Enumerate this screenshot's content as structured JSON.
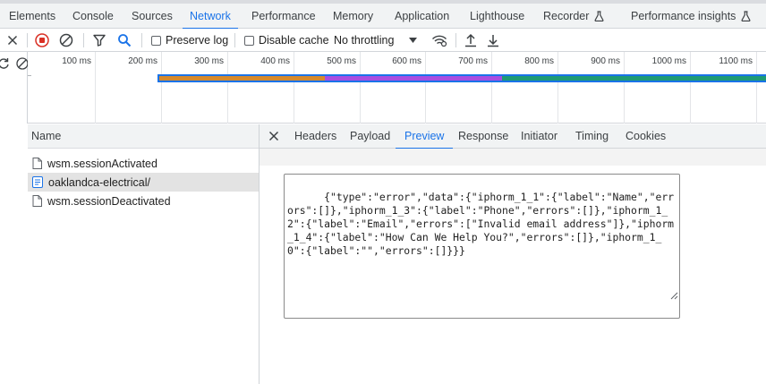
{
  "top_tabs": {
    "items": [
      {
        "label": "Elements"
      },
      {
        "label": "Console"
      },
      {
        "label": "Sources"
      },
      {
        "label": "Network",
        "active": true
      },
      {
        "label": "Performance"
      },
      {
        "label": "Memory"
      },
      {
        "label": "Application"
      },
      {
        "label": "Lighthouse"
      },
      {
        "label": "Recorder",
        "icon": "flask-icon"
      },
      {
        "label": "Performance insights",
        "icon": "flask-icon"
      }
    ]
  },
  "toolbar": {
    "preserve_log": "Preserve log",
    "preserve_log_checked": false,
    "disable_cache": "Disable cache",
    "disable_cache_checked": false,
    "throttling": "No throttling",
    "icons": [
      "close-icon",
      "stop-recording-icon",
      "clear-icon",
      "filter-icon",
      "search-icon",
      "dropdown-arrow-icon",
      "network-conditions-icon",
      "import-har-icon",
      "export-har-icon"
    ]
  },
  "overview": {
    "ticks": [
      "100 ms",
      "200 ms",
      "300 ms",
      "400 ms",
      "500 ms",
      "600 ms",
      "700 ms",
      "800 ms",
      "900 ms",
      "1000 ms",
      "1100 ms"
    ],
    "colors": {
      "orange": "#d68a2c",
      "purple": "#a94de0",
      "green": "#1e9b74",
      "outline": "#1a73e8"
    }
  },
  "request_list": {
    "header": "Name",
    "rows": [
      {
        "name": "wsm.sessionActivated",
        "icon": "document-icon",
        "selected": false
      },
      {
        "name": "oaklandca-electrical/",
        "icon": "document-type-icon",
        "selected": true
      },
      {
        "name": "wsm.sessionDeactivated",
        "icon": "document-icon",
        "selected": false
      }
    ]
  },
  "detail": {
    "tabs": [
      "Headers",
      "Payload",
      "Preview",
      "Response",
      "Initiator",
      "Timing",
      "Cookies"
    ],
    "active_tab": "Preview",
    "preview_text": "{\"type\":\"error\",\"data\":{\"iphorm_1_1\":{\"label\":\"Name\",\"errors\":[]},\"iphorm_1_3\":{\"label\":\"Phone\",\"errors\":[]},\"iphorm_1_2\":{\"label\":\"Email\",\"errors\":[\"Invalid email address\"]},\"iphorm_1_4\":{\"label\":\"How Can We Help You?\",\"errors\":[]},\"iphorm_1_0\":{\"label\":\"\",\"errors\":[]}}}"
  }
}
